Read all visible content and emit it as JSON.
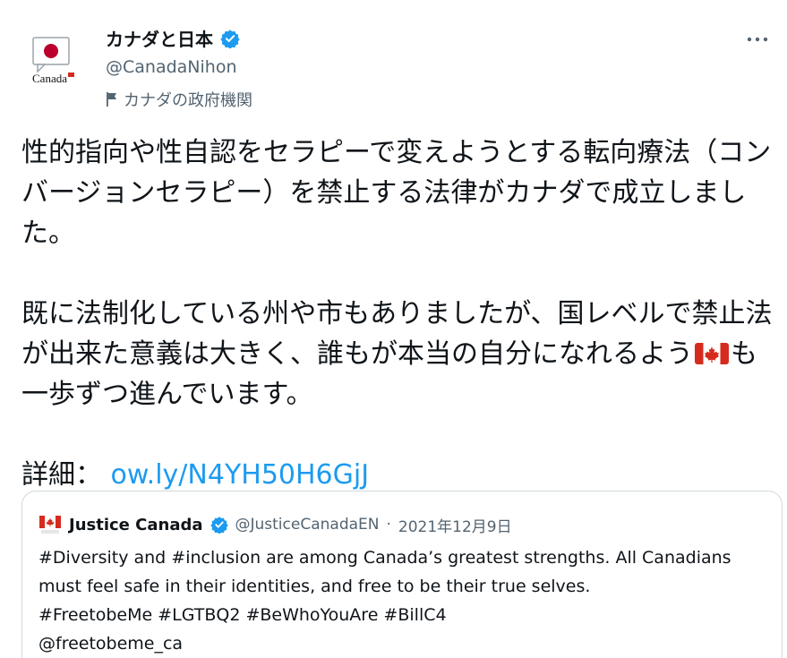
{
  "author": {
    "name": "カナダと日本",
    "handle": "@CanadaNihon",
    "affiliation": "カナダの政府機関",
    "avatar_label": "Canada",
    "avatar_icon": "japan-flag-speech-bubble-icon",
    "verified_icon": "verified-badge-icon"
  },
  "menu": {
    "more_icon": "more-dots-icon"
  },
  "tweet": {
    "para1": "性的指向や性自認をセラピーで変えようとする転向療法（コンバージョンセラピー）を禁止する法律がカナダで成立しました。",
    "para2_before": "既に法制化している州や市もありましたが、国レベルで禁止法が出来た意義は大きく、誰もが本当の自分になれるよう",
    "para2_emoji": "canada-flag-emoji",
    "para2_after": "も一歩ずつ進んでいます。",
    "details_label": "詳細：",
    "link": "ow.ly/N4YH50H6GjJ"
  },
  "quote": {
    "name": "Justice Canada",
    "handle": "@JusticeCanadaEN",
    "separator": " · ",
    "date": "2021年12月9日",
    "avatar_icon": "canada-flag-icon",
    "text": "#Diversity and #inclusion are among Canada’s greatest strengths. All Canadians must feel safe in their identities, and free to be their true selves.\n#FreetobeMe #LGTBQ2 #BeWhoYouAre #BillC4\n@freetobeme_ca"
  },
  "colors": {
    "accent": "#1d9bf0",
    "text": "#0f1419",
    "secondary": "#536471",
    "border": "#cfd9de",
    "canada_red": "#d52b1e",
    "japan_red": "#bc002d"
  }
}
